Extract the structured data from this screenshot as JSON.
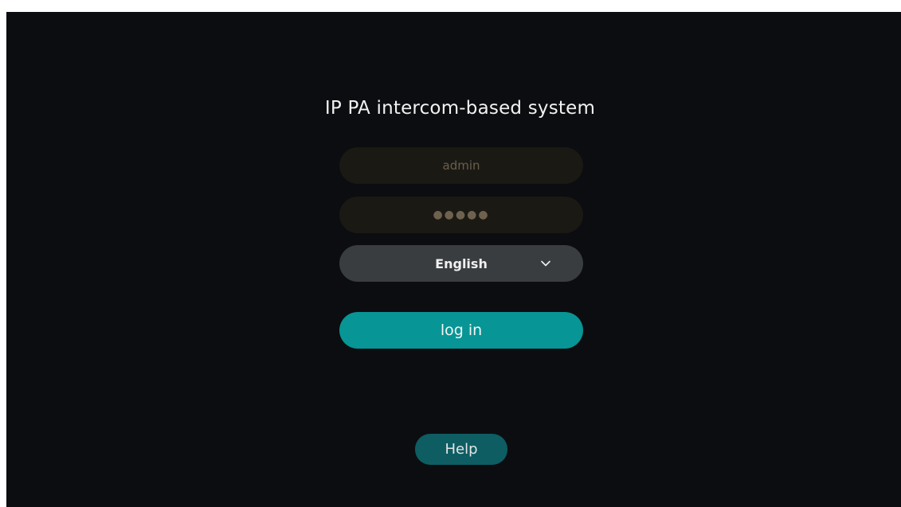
{
  "app": {
    "title": "IP PA intercom-based system"
  },
  "login_form": {
    "username_value": "admin",
    "password_mask": "●●●●●",
    "language_selected": "English",
    "login_label": "log in"
  },
  "help": {
    "label": "Help"
  },
  "icons": {
    "language_dropdown": "chevron-down-icon"
  },
  "colors": {
    "background": "#0c0d10",
    "accent": "#079595",
    "help_button": "#0d5d63",
    "input_background": "#1b1914",
    "select_background": "#3a3d40"
  }
}
